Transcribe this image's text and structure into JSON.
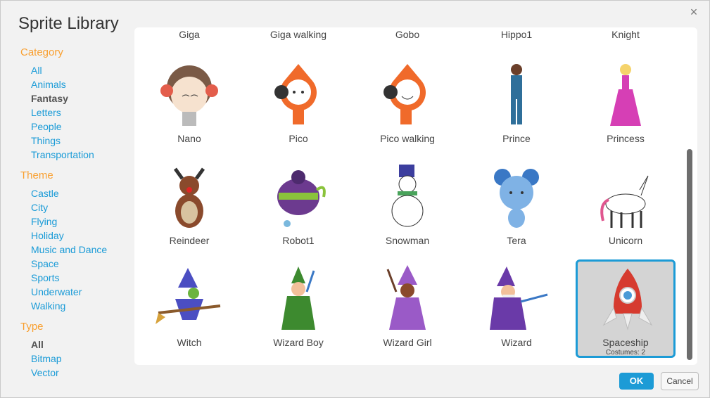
{
  "title": "Sprite Library",
  "close_glyph": "×",
  "sidebar": {
    "category": {
      "title": "Category",
      "items": [
        {
          "label": "All",
          "selected": false
        },
        {
          "label": "Animals",
          "selected": false
        },
        {
          "label": "Fantasy",
          "selected": true
        },
        {
          "label": "Letters",
          "selected": false
        },
        {
          "label": "People",
          "selected": false
        },
        {
          "label": "Things",
          "selected": false
        },
        {
          "label": "Transportation",
          "selected": false
        }
      ]
    },
    "theme": {
      "title": "Theme",
      "items": [
        {
          "label": "Castle",
          "selected": false
        },
        {
          "label": "City",
          "selected": false
        },
        {
          "label": "Flying",
          "selected": false
        },
        {
          "label": "Holiday",
          "selected": false
        },
        {
          "label": "Music and Dance",
          "selected": false
        },
        {
          "label": "Space",
          "selected": false
        },
        {
          "label": "Sports",
          "selected": false
        },
        {
          "label": "Underwater",
          "selected": false
        },
        {
          "label": "Walking",
          "selected": false
        }
      ]
    },
    "type": {
      "title": "Type",
      "items": [
        {
          "label": "All",
          "selected": true
        },
        {
          "label": "Bitmap",
          "selected": false
        },
        {
          "label": "Vector",
          "selected": false
        }
      ]
    }
  },
  "sprites_partial_row": [
    "Giga",
    "Giga walking",
    "Gobo",
    "Hippo1",
    "Knight"
  ],
  "sprites": [
    {
      "name": "Nano",
      "icon": "nano-icon"
    },
    {
      "name": "Pico",
      "icon": "pico-icon"
    },
    {
      "name": "Pico walking",
      "icon": "pico-walking-icon"
    },
    {
      "name": "Prince",
      "icon": "prince-icon"
    },
    {
      "name": "Princess",
      "icon": "princess-icon"
    },
    {
      "name": "Reindeer",
      "icon": "reindeer-icon"
    },
    {
      "name": "Robot1",
      "icon": "robot-icon"
    },
    {
      "name": "Snowman",
      "icon": "snowman-icon"
    },
    {
      "name": "Tera",
      "icon": "tera-icon"
    },
    {
      "name": "Unicorn",
      "icon": "unicorn-icon"
    },
    {
      "name": "Witch",
      "icon": "witch-icon"
    },
    {
      "name": "Wizard Boy",
      "icon": "wizard-boy-icon"
    },
    {
      "name": "Wizard Girl",
      "icon": "wizard-girl-icon"
    },
    {
      "name": "Wizard",
      "icon": "wizard-icon"
    },
    {
      "name": "Spaceship",
      "icon": "spaceship-icon",
      "selected": true,
      "costumes": "Costumes: 2"
    }
  ],
  "buttons": {
    "ok": "OK",
    "cancel": "Cancel"
  },
  "colors": {
    "accent": "#1c9bd6",
    "category_title": "#f9a031",
    "link": "#1a9bd7"
  }
}
